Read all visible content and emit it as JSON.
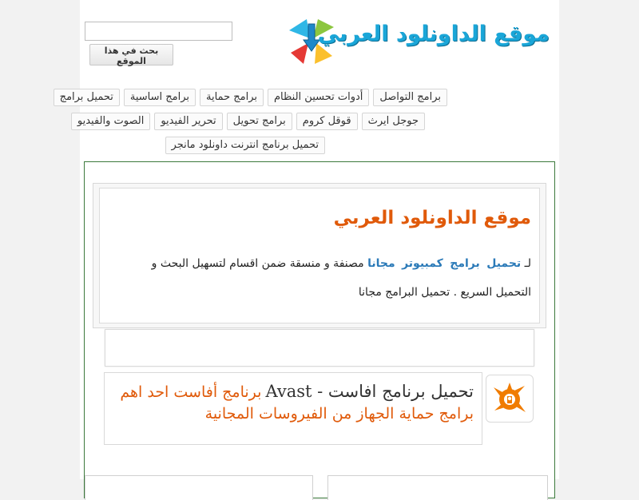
{
  "header": {
    "site_name": "موقع الداونلود العربي",
    "search": {
      "value": "",
      "placeholder": "",
      "button_label": "بحث في هذا الموقع"
    }
  },
  "nav": {
    "row1": [
      "تحميل برامج",
      "برامج اساسية",
      "برامج حماية",
      "أدوات تحسين النظام",
      "برامج التواصل"
    ],
    "row2": [
      "الصوت والفيديو",
      "تحرير الفيديو",
      "برامج تحويل",
      "قوقل كروم",
      "جوجل ايرث"
    ],
    "row3": [
      "تحميل برنامج انترنت داونلود مانجر"
    ]
  },
  "intro": {
    "title": "موقع الداونلود العربي",
    "prefix": "لـ",
    "keywords": [
      "تحميل",
      "برامج",
      "كمبيوتر",
      "مجانا"
    ],
    "text_after": "مصنفة و منسقة ضمن اقسام لتسهيل البحث و التحميل السريع . تحميل البرامج مجانا"
  },
  "post": {
    "title": "تحميل برنامج افاست - Avast",
    "description": "برنامج أفاست احد اهم برامج حماية الجهاز من الفيروسات المجانية",
    "thumbnail_icon": "avast-logo-icon",
    "accent_color": "#f07c00"
  },
  "colors": {
    "title_orange": "#e05a0a",
    "link_blue": "#2b7ab8",
    "logo_blue": "#1aa6d8",
    "border_green": "#3c7a3c"
  }
}
